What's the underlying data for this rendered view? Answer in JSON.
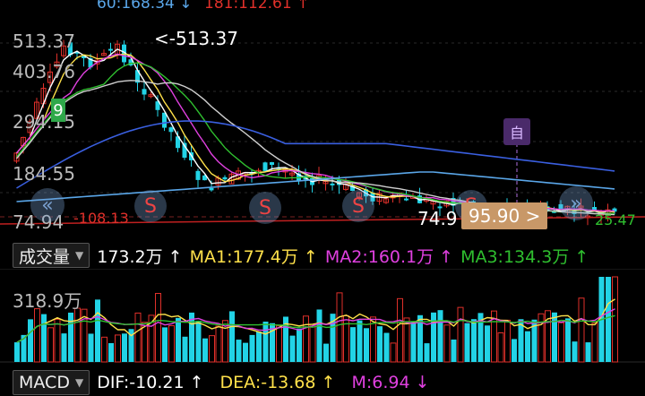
{
  "top_readout": {
    "left": "60:168.34 ↓",
    "right": "181:112.61 ↑"
  },
  "main": {
    "axis_labels": [
      "513.37",
      "403.76",
      "294.15",
      "184.55",
      "74.94"
    ],
    "high_marker": "<-513.37",
    "low_left_marker": "-108.13",
    "price_tag": "74.9",
    "price_box": "95.90 >",
    "right_tag": "25.47",
    "badge": "自",
    "sell_label": "S",
    "nine_badge": "9",
    "nav_left_icon": "«",
    "nav_right_icon": "»",
    "colors": {
      "up": "#e0302a",
      "down": "#22d3e6",
      "ma5": "#ffffff",
      "ma10": "#ffe14a",
      "ma20": "#e040e0",
      "ma30": "#2fbf2f",
      "ma60": "#cfcfcf",
      "ma120": "#3a5fe0",
      "ma250": "#5aa6e8"
    }
  },
  "volume": {
    "selector_label": "成交量",
    "value": "173.2万 ↑",
    "ma1": "MA1:177.4万 ↑",
    "ma2": "MA2:160.1万 ↑",
    "ma3": "MA3:134.3万 ↑",
    "axis_label": "318.9万"
  },
  "macd": {
    "selector_label": "MACD",
    "dif": "DIF:-10.21 ↑",
    "dea": "DEA:-13.68 ↑",
    "m": "M:6.94 ↓"
  }
}
